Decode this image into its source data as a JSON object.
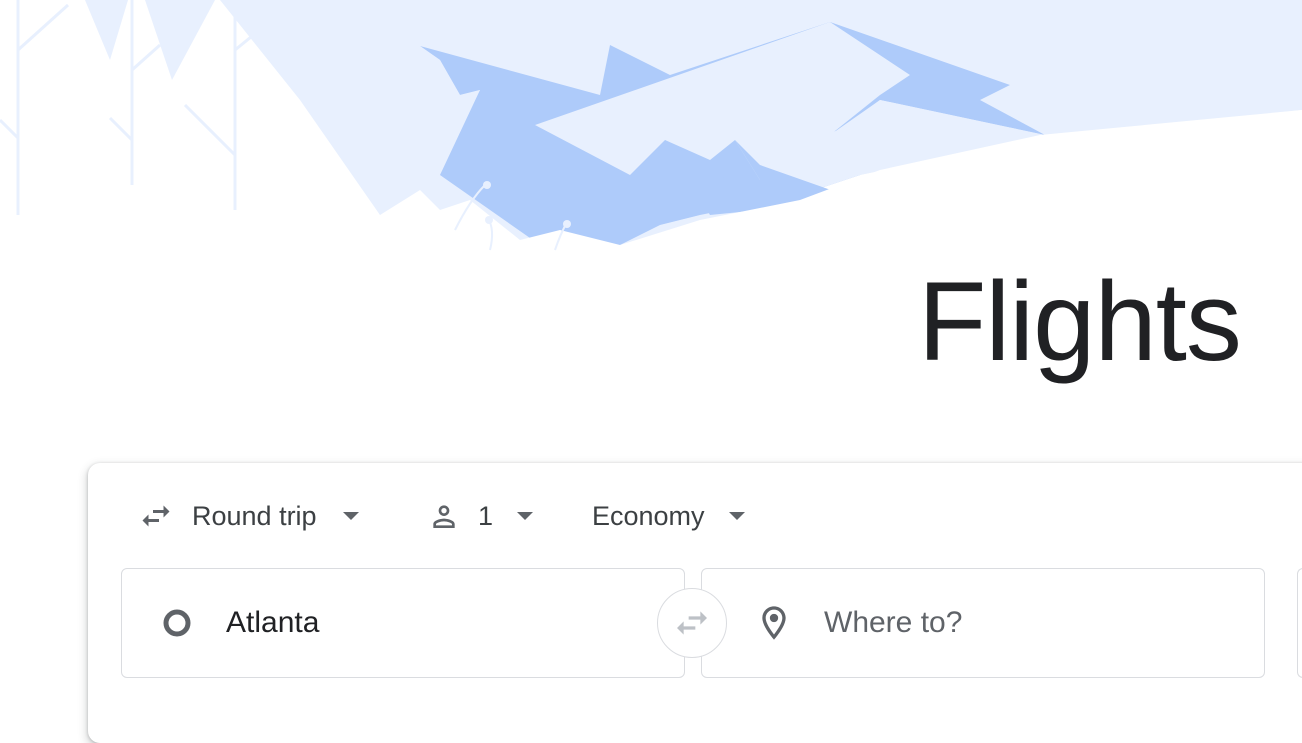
{
  "page": {
    "title": "Flights"
  },
  "search": {
    "trip_type": {
      "label": "Round trip",
      "icon": "swap-horiz-icon"
    },
    "passengers": {
      "count": "1",
      "icon": "person-icon"
    },
    "cabin_class": {
      "label": "Economy"
    },
    "origin": {
      "value": "Atlanta",
      "icon": "origin-circle-icon"
    },
    "destination": {
      "placeholder": "Where to?",
      "icon": "location-pin-icon"
    },
    "swap_button": {
      "icon": "swap-arrows-icon"
    }
  },
  "colors": {
    "hero_light": "#e8f0fe",
    "hero_mid": "#aecbfa",
    "text_primary": "#202124",
    "text_secondary": "#3c4043",
    "icon_gray": "#5f6368",
    "border": "#dadce0"
  }
}
